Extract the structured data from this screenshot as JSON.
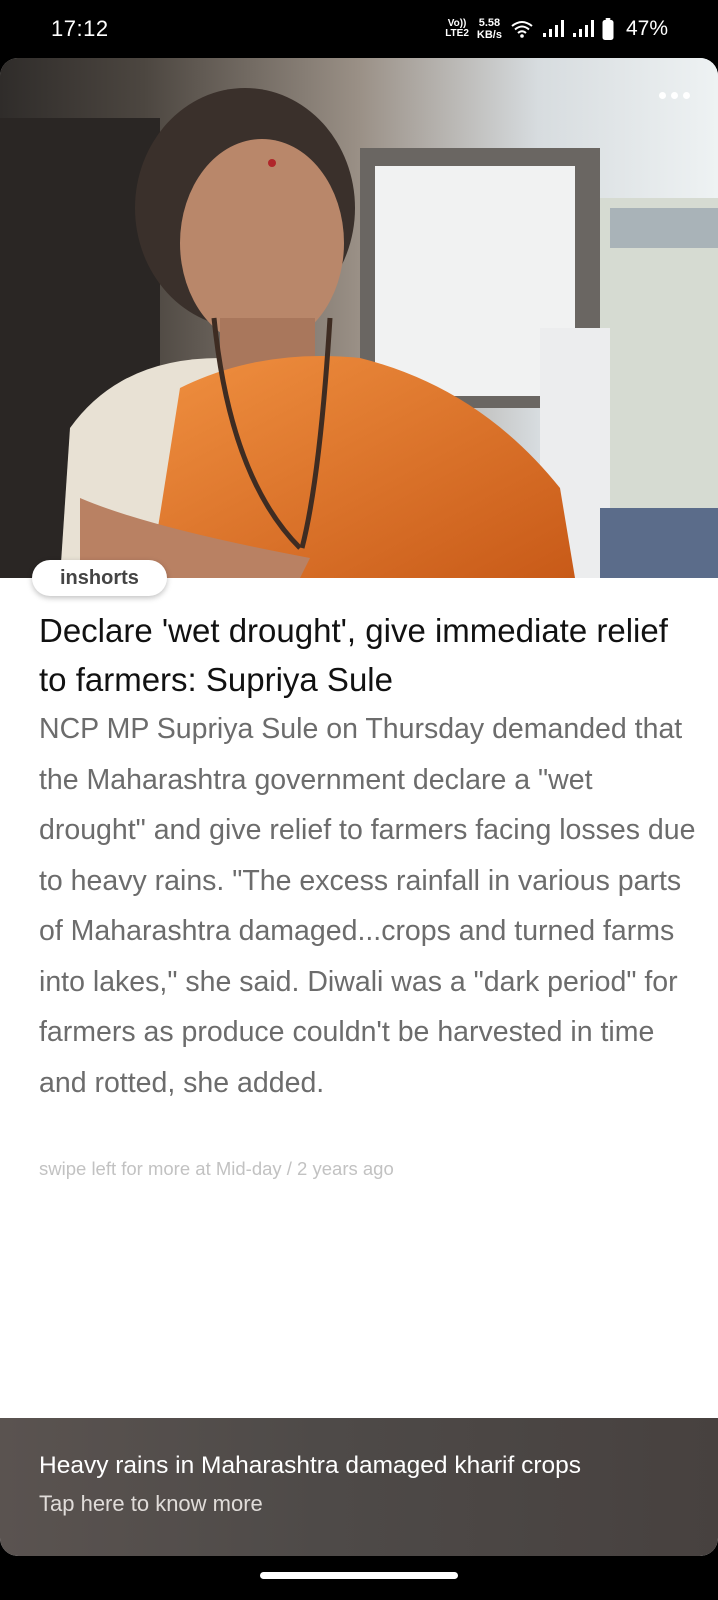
{
  "status_bar": {
    "time": "17:12",
    "volte_top": "Vo))",
    "volte_bottom": "LTE2",
    "net_speed_value": "5.58",
    "net_speed_unit": "KB/s",
    "battery": "47%",
    "icons": [
      "wifi-icon",
      "signal-icon",
      "signal-icon",
      "battery-icon"
    ]
  },
  "article": {
    "brand": "inshorts",
    "headline": "Declare 'wet drought', give immediate relief to farmers: Supriya Sule",
    "body": "NCP MP Supriya Sule on Thursday demanded that the Maharashtra government declare a \"wet drought\" and give relief to farmers facing losses due to heavy rains. \"The excess rainfall in various parts of Maharashtra damaged...crops and turned farms into lakes,\" she said. Diwali was a \"dark period\" for farmers as produce couldn't be harvested in time and rotted, she added.",
    "source_line": "swipe left for more at Mid-day / 2 years ago"
  },
  "banner": {
    "title": "Heavy rains in Maharashtra damaged kharif crops",
    "subtitle": "Tap here to know more"
  },
  "colors": {
    "saree": "#e07a2c",
    "background": "#ffffff",
    "headline": "#111111",
    "body": "#6c6c6c"
  }
}
